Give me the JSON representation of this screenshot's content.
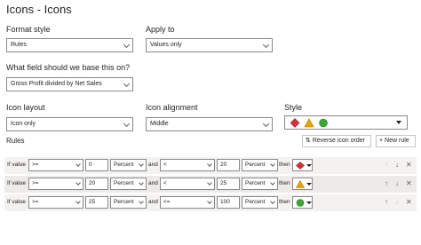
{
  "dialog": {
    "title": "Icons - Icons"
  },
  "format_style": {
    "label": "Format style",
    "value": "Rules"
  },
  "apply_to": {
    "label": "Apply to",
    "value": "Values only"
  },
  "base_field": {
    "label": "What field should we base this on?",
    "value": "Gross Profit divided by Net Sales"
  },
  "icon_layout": {
    "label": "Icon layout",
    "value": "Icon only"
  },
  "icon_alignment": {
    "label": "Icon alignment",
    "value": "Middle"
  },
  "style": {
    "label": "Style",
    "icons": [
      "red-diamond-icon",
      "yellow-triangle-icon",
      "green-circle-icon"
    ]
  },
  "rules": {
    "label": "Rules",
    "reverse_label": "Reverse icon order",
    "new_rule_label": "New rule",
    "rows": [
      {
        "if_label": "If value",
        "op1": ">=",
        "val1": "0",
        "unit1": "Percent",
        "and_label": "and",
        "op2": "<",
        "val2": "20",
        "unit2": "Percent",
        "then_label": "then",
        "icon": "red-diamond-icon",
        "icon_color": "#d13438"
      },
      {
        "if_label": "If value",
        "op1": ">=",
        "val1": "20",
        "unit1": "Percent",
        "and_label": "and",
        "op2": "<",
        "val2": "25",
        "unit2": "Percent",
        "then_label": "then",
        "icon": "yellow-triangle-icon",
        "icon_color": "#e8a202"
      },
      {
        "if_label": "If value",
        "op1": ">=",
        "val1": "25",
        "unit1": "Percent",
        "and_label": "and",
        "op2": "<=",
        "val2": "100",
        "unit2": "Percent",
        "then_label": "then",
        "icon": "green-circle-icon",
        "icon_color": "#3fa535"
      }
    ]
  },
  "colors": {
    "red": "#d13438",
    "yellow": "#e8a202",
    "green": "#3fa535"
  }
}
